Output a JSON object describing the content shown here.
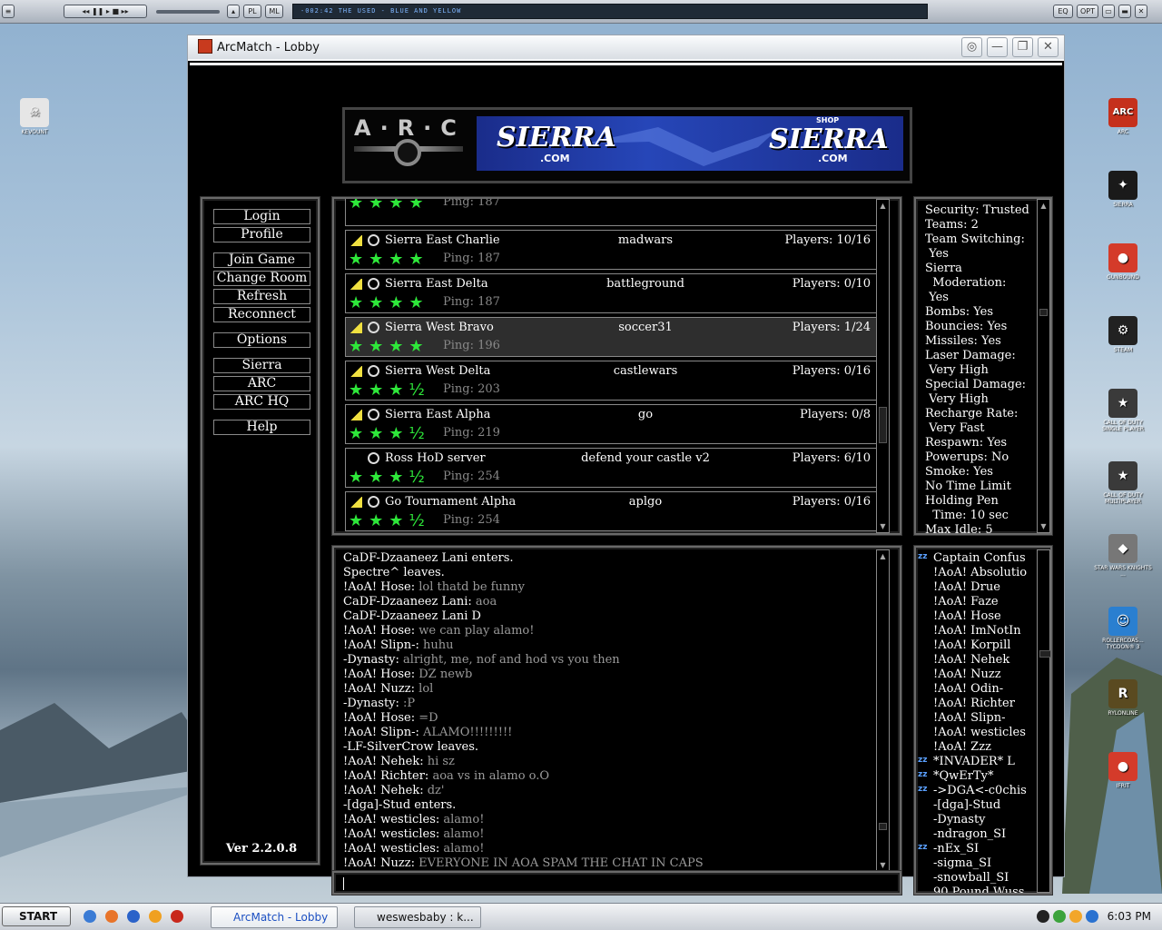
{
  "winamp": {
    "buttons": [
      "PL",
      "ML",
      "EQ",
      "OPT"
    ],
    "display": "-002:42  THE USED - BLUE AND YELLOW"
  },
  "desktop_icons": [
    {
      "label": "KEVOUNT",
      "glyph": "☠",
      "color": "#e6e6e6"
    },
    {
      "label": "ARC",
      "glyph": "ARC",
      "color": "#c5301c"
    },
    {
      "label": "SIERRA",
      "glyph": "✦",
      "color": "#1a1a1a"
    },
    {
      "label": "GUNBOUND",
      "glyph": "●",
      "color": "#d43b2a"
    },
    {
      "label": "STEAM",
      "glyph": "⚙",
      "color": "#222"
    },
    {
      "label": "CALL OF DUTY SINGLE PLAYER",
      "glyph": "★",
      "color": "#3a3a3a"
    },
    {
      "label": "CALL OF DUTY MULTIPLAYER",
      "glyph": "★",
      "color": "#3a3a3a"
    },
    {
      "label": "STAR WARS KNIGHTS ...",
      "glyph": "◆",
      "color": "#777"
    },
    {
      "label": "ROLLERCOAS... TYCOON® 3",
      "glyph": "☺",
      "color": "#2a7fd0"
    },
    {
      "label": "RYLONLINE",
      "glyph": "R",
      "color": "#5a4a20"
    },
    {
      "label": "IFRIT",
      "glyph": "●",
      "color": "#d43b2a"
    }
  ],
  "window": {
    "title": "ArcMatch - Lobby"
  },
  "banner": {
    "arc_logo": "A·R·C",
    "sierra_left": "SIERRA",
    "sierra_left_dom": ".COM",
    "shop": "SHOP",
    "sierra_right": "SIERRA",
    "sierra_right_dom": ".COM"
  },
  "menu": {
    "items": [
      "Login",
      "Profile",
      "Join Game",
      "Change Room",
      "Refresh",
      "Reconnect",
      "Options",
      "Sierra",
      "ARC",
      "ARC HQ",
      "Help"
    ],
    "version": "Ver 2.2.0.8"
  },
  "servers": [
    {
      "name": "Sierra East Charlie",
      "mode": "madwars",
      "players": "Players: 10/16",
      "ping": "Ping: 187",
      "stars": "★★★★",
      "signal": true,
      "locked": false,
      "selected": false
    },
    {
      "name": "Sierra East Delta",
      "mode": "battleground",
      "players": "Players: 0/10",
      "ping": "Ping: 187",
      "stars": "★★★★",
      "signal": true,
      "locked": false,
      "selected": false
    },
    {
      "name": "Sierra West Bravo",
      "mode": "soccer31",
      "players": "Players: 1/24",
      "ping": "Ping: 196",
      "stars": "★★★★",
      "signal": true,
      "locked": false,
      "selected": true
    },
    {
      "name": "Sierra West Delta",
      "mode": "castlewars",
      "players": "Players: 0/16",
      "ping": "Ping: 203",
      "stars": "★★★½",
      "signal": true,
      "locked": false,
      "selected": false
    },
    {
      "name": "Sierra East Alpha",
      "mode": "go",
      "players": "Players: 0/8",
      "ping": "Ping: 219",
      "stars": "★★★½",
      "signal": true,
      "locked": false,
      "selected": false
    },
    {
      "name": "Ross HoD server",
      "mode": "defend your castle v2",
      "players": "Players: 6/10",
      "ping": "Ping: 254",
      "stars": "★★★½",
      "signal": false,
      "locked": false,
      "selected": false
    },
    {
      "name": "Go Tournament Alpha",
      "mode": "aplgo",
      "players": "Players: 0/16",
      "ping": "Ping: 254",
      "stars": "★★★½",
      "signal": true,
      "locked": true,
      "selected": false
    }
  ],
  "partial_server": {
    "ping": "Ping: 187",
    "stars": "★★★★"
  },
  "game_info": [
    "Security: Trusted",
    "Teams: 2",
    "Team Switching:",
    " Yes",
    "Sierra",
    "  Moderation:",
    " Yes",
    "Bombs: Yes",
    "Bouncies: Yes",
    "Missiles: Yes",
    "Laser Damage:",
    " Very High",
    "Special Damage:",
    " Very High",
    "Recharge Rate:",
    " Very Fast",
    "Respawn: Yes",
    "Powerups: No",
    "Smoke: Yes",
    "No Time Limit",
    "Holding Pen",
    "  Time: 10 sec",
    "Max Idle: 5"
  ],
  "chat": [
    {
      "who": "CaDF-Dzaaneez Lani",
      "msg": "",
      "event": "enters."
    },
    {
      "who": "Spectre^",
      "msg": "",
      "event": "leaves."
    },
    {
      "who": "!AoA! Hose:",
      "msg": "lol thatd be funny"
    },
    {
      "who": "CaDF-Dzaaneez Lani:",
      "msg": "aoa"
    },
    {
      "who": "CaDF-Dzaaneez Lani D",
      "msg": ""
    },
    {
      "who": "!AoA! Hose:",
      "msg": "we can play alamo!"
    },
    {
      "who": "!AoA! Slipn-:",
      "msg": "huhu"
    },
    {
      "who": "-Dynasty:",
      "msg": "alright, me, nof and hod vs you then"
    },
    {
      "who": "!AoA! Hose:",
      "msg": "DZ newb"
    },
    {
      "who": "!AoA! Nuzz:",
      "msg": "lol"
    },
    {
      "who": "-Dynasty:",
      "msg": ":P"
    },
    {
      "who": "!AoA! Hose:",
      "msg": "=D"
    },
    {
      "who": "!AoA! Slipn-:",
      "msg": "ALAMO!!!!!!!!!"
    },
    {
      "who": "-LF-SilverCrow",
      "msg": "",
      "event": "leaves."
    },
    {
      "who": "!AoA! Nehek:",
      "msg": "hi sz"
    },
    {
      "who": "!AoA! Richter:",
      "msg": "aoa vs in alamo o.O"
    },
    {
      "who": "!AoA! Nehek:",
      "msg": "dz'"
    },
    {
      "who": "-[dga]-Stud",
      "msg": "",
      "event": "enters."
    },
    {
      "who": "!AoA! westicles:",
      "msg": "alamo!"
    },
    {
      "who": "!AoA! westicles:",
      "msg": "alamo!"
    },
    {
      "who": "!AoA! westicles:",
      "msg": "alamo!"
    },
    {
      "who": "!AoA! Nuzz:",
      "msg": "EVERYONE IN AOA SPAM THE CHAT IN CAPS"
    }
  ],
  "users": [
    {
      "name": "Captain Confus",
      "zz": true
    },
    {
      "name": "!AoA! Absolutio",
      "zz": false
    },
    {
      "name": "!AoA! Drue",
      "zz": false
    },
    {
      "name": "!AoA! Faze",
      "zz": false
    },
    {
      "name": "!AoA! Hose",
      "zz": false
    },
    {
      "name": "!AoA! ImNotIn",
      "zz": false
    },
    {
      "name": "!AoA! Korpill",
      "zz": false
    },
    {
      "name": "!AoA! Nehek",
      "zz": false
    },
    {
      "name": "!AoA! Nuzz",
      "zz": false
    },
    {
      "name": "!AoA! Odin-",
      "zz": false
    },
    {
      "name": "!AoA! Richter",
      "zz": false
    },
    {
      "name": "!AoA! Slipn-",
      "zz": false
    },
    {
      "name": "!AoA! westicles",
      "zz": false
    },
    {
      "name": "!AoA! Zzz",
      "zz": false
    },
    {
      "name": "*INVADER* L",
      "zz": true
    },
    {
      "name": "*QwErTy*",
      "zz": true
    },
    {
      "name": "->DGA<-c0chis",
      "zz": true
    },
    {
      "name": "-[dga]-Stud",
      "zz": false
    },
    {
      "name": "-Dynasty",
      "zz": false
    },
    {
      "name": "-ndragon_SI",
      "zz": false
    },
    {
      "name": "-nEx_SI",
      "zz": true
    },
    {
      "name": "-sigma_SI",
      "zz": false
    },
    {
      "name": "-snowball_SI",
      "zz": false
    },
    {
      "name": "90 Pound Wuss",
      "zz": false
    }
  ],
  "taskbar": {
    "start": "START",
    "tasks": [
      "ArcMatch - Lobby",
      "weswesbaby : k..."
    ],
    "clock": "6:03 PM"
  }
}
